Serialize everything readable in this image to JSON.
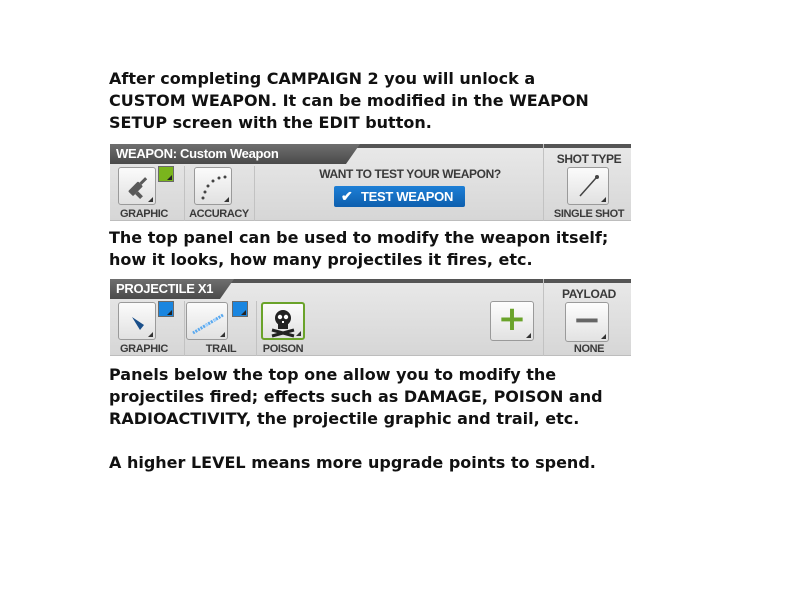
{
  "intro_text": "After completing CAMPAIGN 2 you will unlock a\nCUSTOM WEAPON. It can be modified in the WEAPON\nSETUP screen with the EDIT button.",
  "weapon_panel": {
    "title": "WEAPON: Custom Weapon",
    "graphic_label": "GRAPHIC",
    "accuracy_label": "ACCURACY",
    "prompt": "WANT TO TEST YOUR WEAPON?",
    "test_button_label": "TEST WEAPON",
    "test_button_icon": "✔",
    "shot_type_header": "SHOT TYPE",
    "shot_type_value": "SINGLE SHOT",
    "colors": {
      "graphic_badge": "#7ab51d",
      "button": "#1573c8"
    }
  },
  "mid_text": "The top panel can be used to modify the weapon itself;\nhow it looks, how many projectiles it fires, etc.",
  "projectile_panel": {
    "title": "PROJECTILE X1",
    "graphic_label": "GRAPHIC",
    "trail_label": "TRAIL",
    "poison_label": "POISON",
    "payload_header": "PAYLOAD",
    "payload_value": "NONE",
    "add_icon": "+",
    "remove_icon": "−",
    "colors": {
      "badge": "#1a86e0",
      "poison_border": "#6aa32a",
      "add": "#6aa32a"
    }
  },
  "lower_text": "Panels below the top one allow you to modify the\nprojectiles fired; effects such as DAMAGE, POISON and\nRADIOACTIVITY, the projectile graphic and trail, etc.",
  "final_text": "A higher LEVEL means more upgrade points to spend."
}
